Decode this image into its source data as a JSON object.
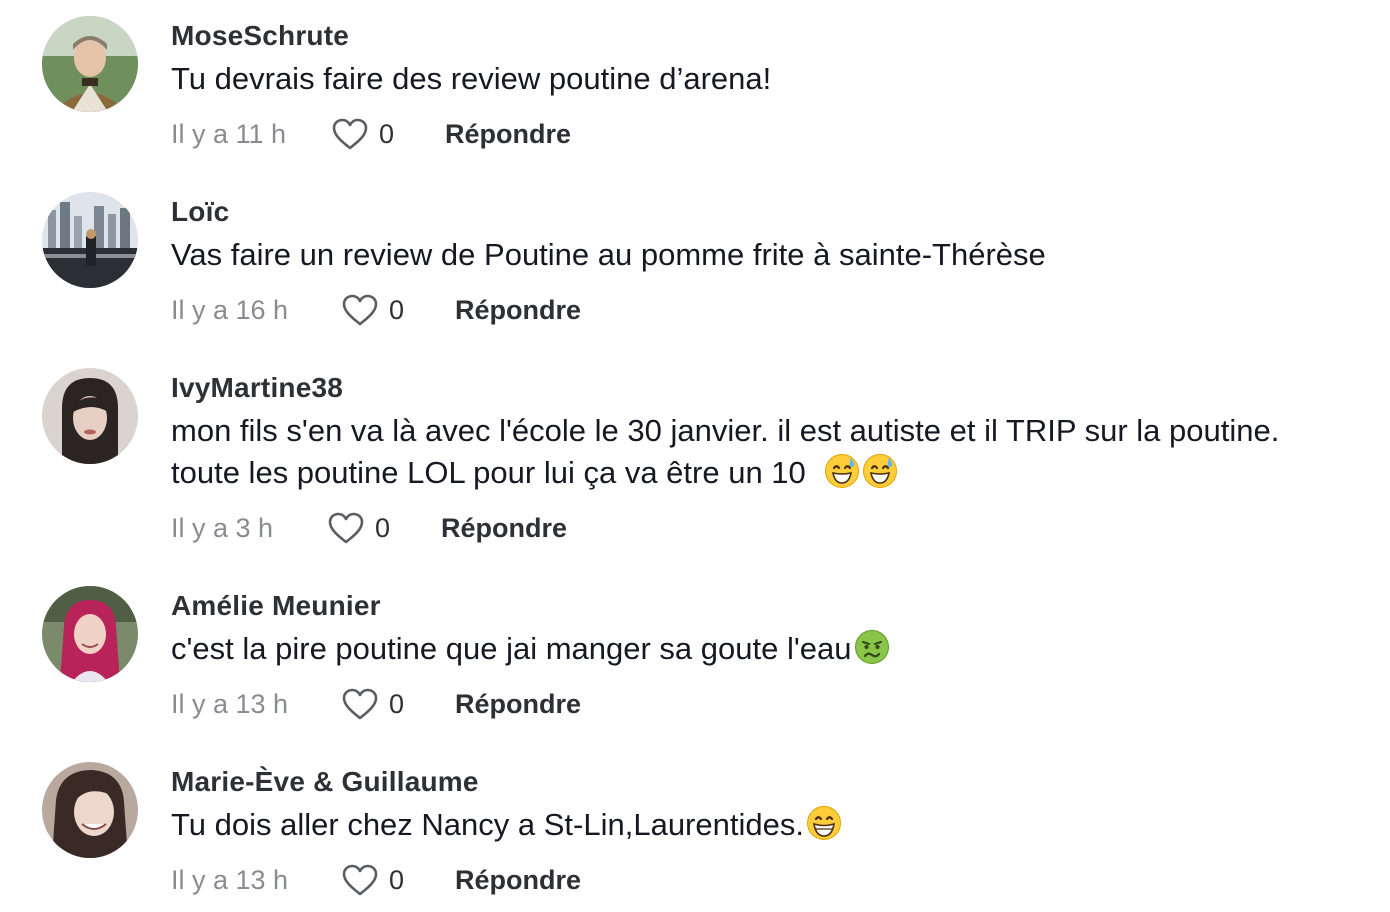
{
  "comments": [
    {
      "username": "MoseSchrute",
      "text": [
        "Tu devrais faire des review poutine d’arena!"
      ],
      "emoji": [],
      "timestamp": "Il y a 11 h",
      "likes": "0",
      "reply_label": "Répondre",
      "avatar_icon": "avatar-man-outdoor"
    },
    {
      "username": "Loïc",
      "text": [
        "Vas faire un review de Poutine au pomme frite à sainte-Thérèse"
      ],
      "emoji": [],
      "timestamp": "Il y a 16 h",
      "likes": "0",
      "reply_label": "Répondre",
      "avatar_icon": "avatar-city-skyline"
    },
    {
      "username": "IvyMartine38",
      "text": [
        "mon fils s'en va là avec l'école le 30 janvier. il est autiste et il TRIP sur la poutine.",
        "toute les poutine LOL pour lui ça va être un 10"
      ],
      "emoji": [
        "grinning-sweat-emoji",
        "grinning-sweat-emoji"
      ],
      "timestamp": "Il y a 3 h",
      "likes": "0",
      "reply_label": "Répondre",
      "avatar_icon": "avatar-woman-dark-hair"
    },
    {
      "username": "Amélie Meunier",
      "text": [
        "c'est la pire poutine que jai manger sa goute l'eau"
      ],
      "emoji": [
        "nauseated-face-emoji"
      ],
      "timestamp": "Il y a 13 h",
      "likes": "0",
      "reply_label": "Répondre",
      "avatar_icon": "avatar-woman-red-hair"
    },
    {
      "username": "Marie-Ève & Guillaume",
      "text": [
        "Tu dois aller chez Nancy a St-Lin,Laurentides."
      ],
      "emoji": [
        "grinning-face-emoji"
      ],
      "timestamp": "Il y a 13 h",
      "likes": "0",
      "reply_label": "Répondre",
      "avatar_icon": "avatar-woman-smiling"
    }
  ],
  "colors": {
    "username": "#2f3036",
    "text": "#161823",
    "muted": "#8a8b91"
  }
}
